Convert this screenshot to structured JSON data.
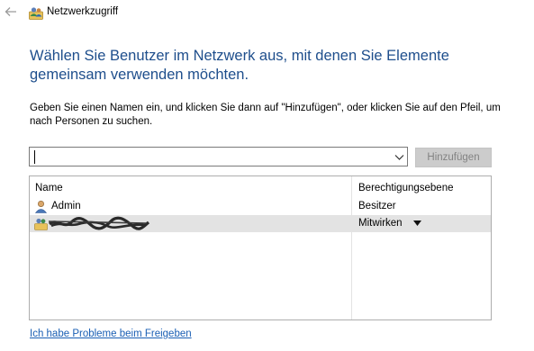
{
  "window": {
    "title": "Netzwerkzugriff",
    "back_icon": "back-arrow-icon",
    "app_icon": "network-users-icon"
  },
  "heading": "Wählen Sie Benutzer im Netzwerk aus, mit denen Sie Elemente gemeinsam verwenden möchten.",
  "instruction": "Geben Sie einen Namen ein, und klicken Sie dann auf \"Hinzufügen\", oder klicken Sie auf den Pfeil, um nach Personen zu suchen.",
  "name_input": {
    "value": "",
    "placeholder": ""
  },
  "add_button": {
    "label": "Hinzufügen",
    "enabled": false
  },
  "list": {
    "columns": {
      "name": "Name",
      "permission": "Berechtigungsebene"
    },
    "rows": [
      {
        "name": "Admin",
        "permission": "Besitzer",
        "icon": "user-icon",
        "selected": false
      },
      {
        "name": "",
        "permission": "Mitwirken",
        "icon": "user-group-icon",
        "selected": true,
        "name_redacted": true
      }
    ]
  },
  "help_link": "Ich habe Probleme beim Freigeben",
  "colors": {
    "heading": "#1e4e8c",
    "link": "#1a5fb4",
    "selected_row": "#e3e3e3",
    "disabled_button_bg": "#cccccc",
    "disabled_button_text": "#838383"
  }
}
